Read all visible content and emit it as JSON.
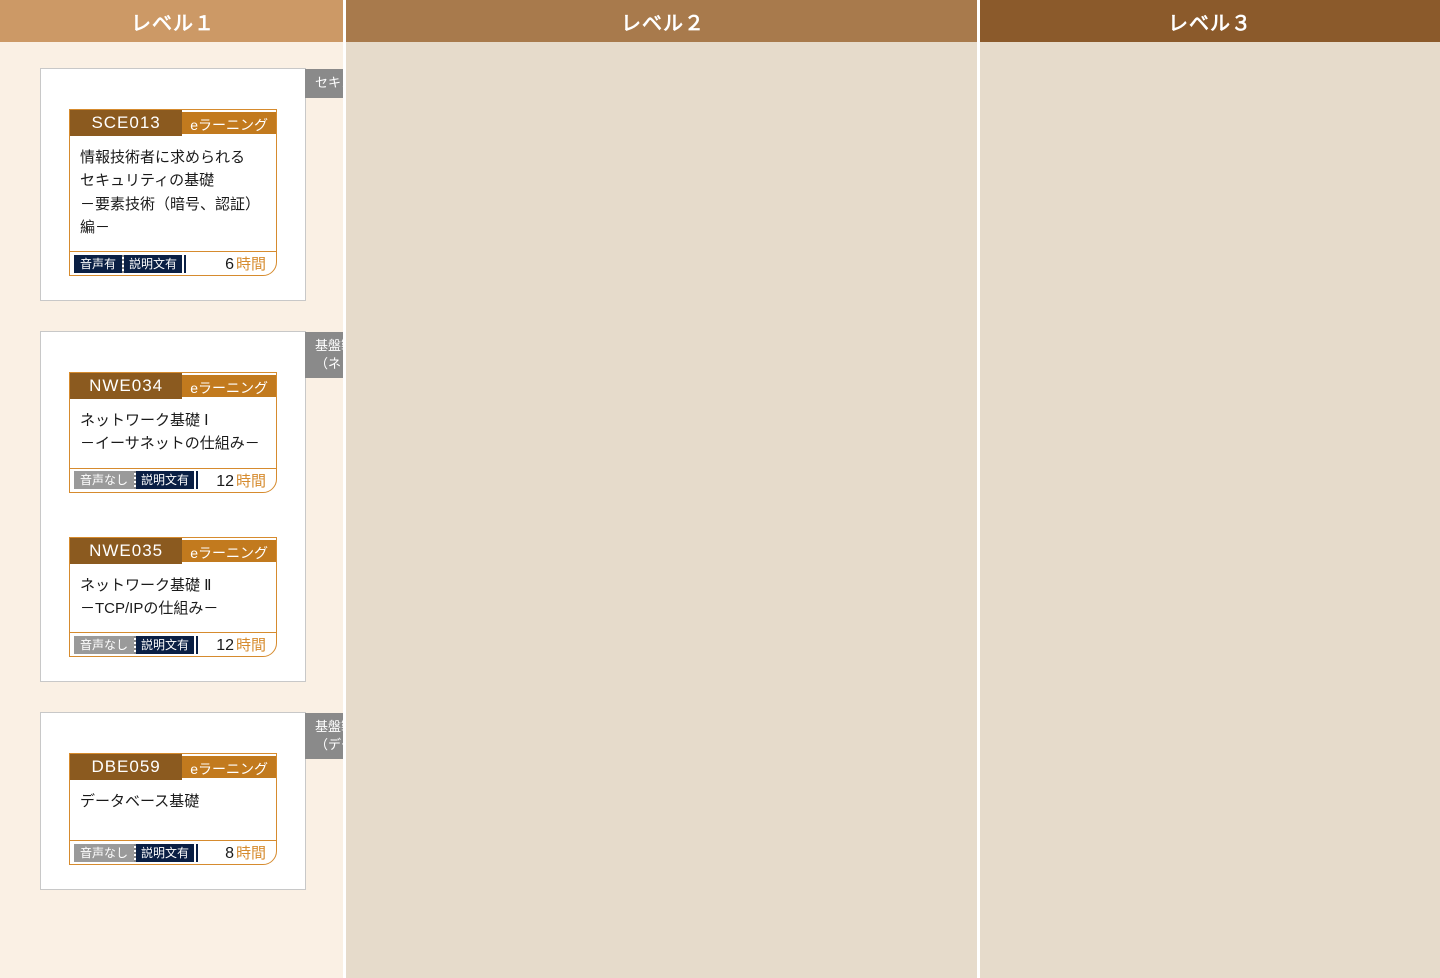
{
  "levels": {
    "col1": "レベル１",
    "col2": "レベル２",
    "col3": "レベル３"
  },
  "labels": {
    "elearning": "eラーニング",
    "hours": "時間",
    "audio_yes": "音声有",
    "audio_no": "音声なし",
    "desc_yes": "説明文有"
  },
  "groups": [
    {
      "tag": "セキュリティ",
      "courses": [
        {
          "code": "SCE013",
          "title": "情報技術者に求められる\nセキュリティの基礎\n－要素技術（暗号、認証）編－",
          "audio": "yes",
          "hours": "6"
        }
      ]
    },
    {
      "tag": "基盤製品\n（ネットワーク）",
      "courses": [
        {
          "code": "NWE034",
          "title": "ネットワーク基礎 Ⅰ\n－イーサネットの仕組み－",
          "audio": "no",
          "hours": "12"
        },
        {
          "code": "NWE035",
          "title": "ネットワーク基礎 Ⅱ\n－TCP/IPの仕組み－",
          "audio": "no",
          "hours": "12"
        }
      ]
    },
    {
      "tag": "基盤製品\n（データベース）",
      "courses": [
        {
          "code": "DBE059",
          "title": "データベース基礎",
          "audio": "no",
          "hours": "8"
        }
      ]
    }
  ]
}
